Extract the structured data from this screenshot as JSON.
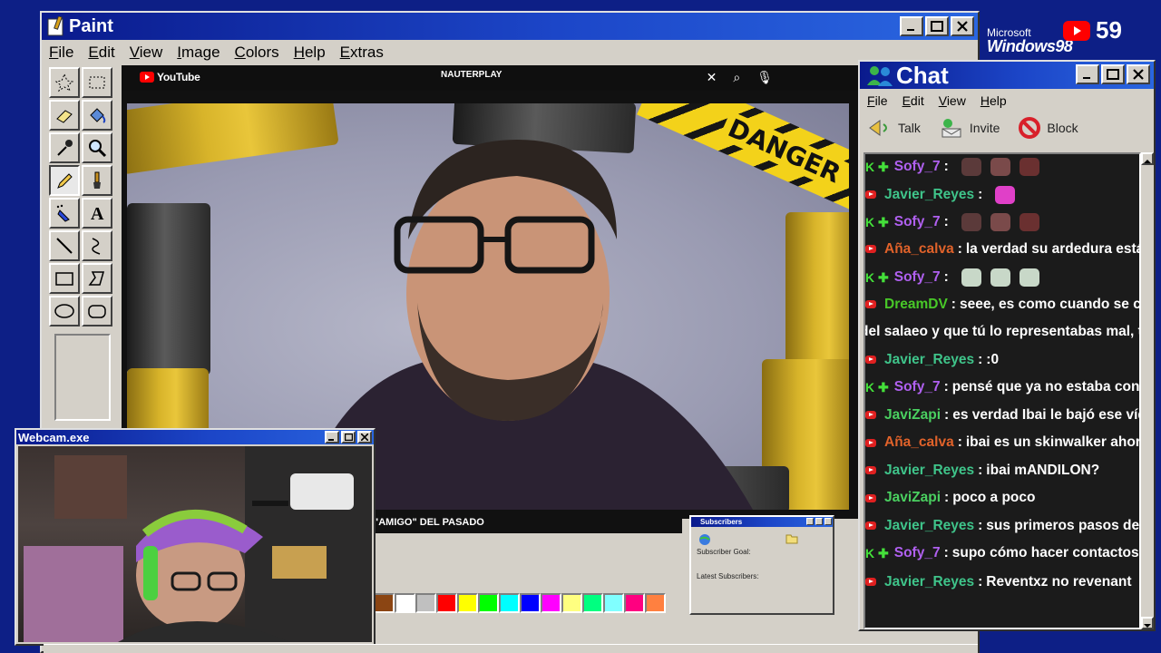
{
  "paint": {
    "title": "Paint",
    "menu": [
      "File",
      "Edit",
      "View",
      "Image",
      "Colors",
      "Help",
      "Extras"
    ],
    "tools": [
      "free-select",
      "rect-select",
      "eraser",
      "fill",
      "color-picker",
      "magnifier",
      "pencil",
      "brush",
      "airbrush",
      "text",
      "line",
      "curve",
      "rectangle",
      "polygon",
      "ellipse",
      "rounded-rect"
    ],
    "active_tool": "pencil",
    "palette": [
      "#8b4513",
      "#ffffff",
      "#c0c0c0",
      "#ff0000",
      "#ffff00",
      "#00ff00",
      "#00ffff",
      "#0000ff",
      "#ff00ff",
      "#ffff80",
      "#00ff80",
      "#80ffff",
      "#ff0080",
      "#ff8040"
    ]
  },
  "stream": {
    "brand": "YouTube",
    "search_text": "NAUTERPLAY",
    "danger_text": "DANGER",
    "caption": "\"AMIGO\" DEL PASADO"
  },
  "subscribers": {
    "title": "Subscribers",
    "goal_label": "Subscriber Goal:",
    "latest_label": "Latest Subscribers:"
  },
  "branding": {
    "microsoft": "Microsoft",
    "windows": "Windows98",
    "youtube_count": "59"
  },
  "chat": {
    "title": "Chat",
    "menu": [
      "File",
      "Edit",
      "View",
      "Help"
    ],
    "tools": [
      "Talk",
      "Invite",
      "Block"
    ],
    "messages": [
      {
        "platform": "kick",
        "user": "Sofy_7",
        "color": "#b060f0",
        "text": "",
        "emotes": 3
      },
      {
        "platform": "yt",
        "user": "Javier_Reyes",
        "color": "#3fc48a",
        "text": "",
        "emotes": 1
      },
      {
        "platform": "kick",
        "user": "Sofy_7",
        "color": "#b060f0",
        "text": "",
        "emotes": 3
      },
      {
        "platform": "yt",
        "user": "Aña_calva",
        "color": "#e0622a",
        "text": "la verdad su ardedura está just",
        "emotes": 0
      },
      {
        "platform": "kick",
        "user": "Sofy_7",
        "color": "#b060f0",
        "text": "",
        "emotes": 3
      },
      {
        "platform": "yt",
        "user": "DreamDV",
        "color": "#48c828",
        "text": "seee, es como cuando se creen",
        "emotes": 0
      },
      {
        "platform": "none",
        "user": "",
        "color": "#ffffff",
        "text": "del salaeo y que tú lo representabas mal, tiene",
        "emotes": 0
      },
      {
        "platform": "yt",
        "user": "Javier_Reyes",
        "color": "#3fc48a",
        "text": ":0",
        "emotes": 0
      },
      {
        "platform": "kick",
        "user": "Sofy_7",
        "color": "#b060f0",
        "text": "pensé que ya no estaba con esa",
        "emotes": 0
      },
      {
        "platform": "yt",
        "user": "JaviZapi",
        "color": "#4ad060",
        "text": "es verdad Ibai le bajó ese vídeo j",
        "emotes": 0
      },
      {
        "platform": "yt",
        "user": "Aña_calva",
        "color": "#e0622a",
        "text": "ibai es un skinwalker ahora mis",
        "emotes": 0
      },
      {
        "platform": "yt",
        "user": "Javier_Reyes",
        "color": "#3fc48a",
        "text": "ibai mANDILON?",
        "emotes": 0
      },
      {
        "platform": "yt",
        "user": "JaviZapi",
        "color": "#4ad060",
        "text": "poco a poco",
        "emotes": 0
      },
      {
        "platform": "yt",
        "user": "Javier_Reyes",
        "color": "#3fc48a",
        "text": "sus primeros pasos de Ibai",
        "emotes": 0
      },
      {
        "platform": "kick",
        "user": "Sofy_7",
        "color": "#b060f0",
        "text": "supo cómo hacer contactos",
        "emotes": 0
      },
      {
        "platform": "yt",
        "user": "Javier_Reyes",
        "color": "#3fc48a",
        "text": "Reventxz no revenant",
        "emotes": 1
      }
    ]
  },
  "webcam": {
    "title": "Webcam.exe"
  }
}
